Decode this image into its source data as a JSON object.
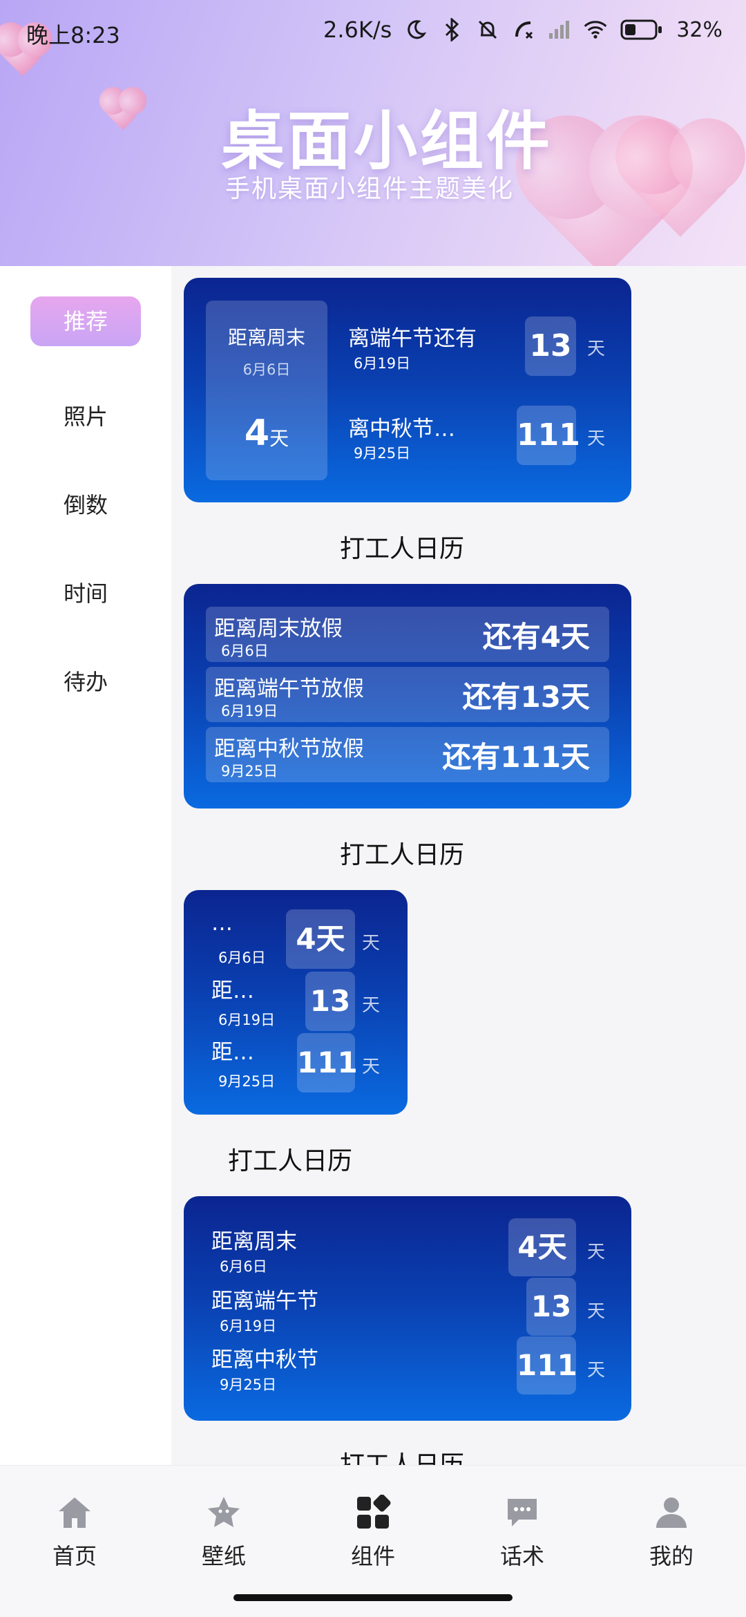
{
  "status_bar": {
    "time": "晚上8:23",
    "network_speed": "2.6K/s",
    "battery": "32%"
  },
  "header": {
    "title": "桌面小组件",
    "subtitle": "手机桌面小组件主题美化"
  },
  "sidebar": {
    "items": [
      {
        "label": "推荐",
        "active": true
      },
      {
        "label": "照片"
      },
      {
        "label": "倒数"
      },
      {
        "label": "时间"
      },
      {
        "label": "待办"
      }
    ]
  },
  "widgets": [
    {
      "caption": "打工人日历",
      "left_panel": {
        "label": "距离周末",
        "date": "6月6日",
        "days": "4",
        "unit": "天"
      },
      "rows": [
        {
          "label": "离端午节还有",
          "date": "6月19日",
          "days": "13",
          "unit": "天"
        },
        {
          "label": "离中秋节…",
          "date": "9月25日",
          "days": "111",
          "unit": "天"
        }
      ]
    },
    {
      "caption": "打工人日历",
      "rows": [
        {
          "label": "距离周末放假",
          "date": "6月6日",
          "text": "还有4天"
        },
        {
          "label": "距离端午节放假",
          "date": "6月19日",
          "text": "还有13天"
        },
        {
          "label": "距离中秋节放假",
          "date": "9月25日",
          "text": "还有111天"
        }
      ]
    },
    {
      "caption": "打工人日历",
      "rows": [
        {
          "label": "…",
          "date": "6月6日",
          "days": "4天",
          "unit": "天"
        },
        {
          "label": "距…",
          "date": "6月19日",
          "days": "13",
          "unit": "天"
        },
        {
          "label": "距…",
          "date": "9月25日",
          "days": "111",
          "unit": "天"
        }
      ]
    },
    {
      "caption": "打工人日历",
      "rows": [
        {
          "label": "距离周末",
          "date": "6月6日",
          "days": "4天",
          "unit": "天"
        },
        {
          "label": "距离端午节",
          "date": "6月19日",
          "days": "13",
          "unit": "天"
        },
        {
          "label": "距离中秋节",
          "date": "9月25日",
          "days": "111",
          "unit": "天"
        }
      ]
    }
  ],
  "bottom_nav": {
    "items": [
      {
        "label": "首页",
        "icon": "home-icon"
      },
      {
        "label": "壁纸",
        "icon": "star-icon"
      },
      {
        "label": "组件",
        "icon": "widgets-icon",
        "active": true
      },
      {
        "label": "话术",
        "icon": "chat-icon"
      },
      {
        "label": "我的",
        "icon": "profile-icon"
      }
    ]
  },
  "colors": {
    "card_top": "#0b2590",
    "card_bottom": "#0a6ae0",
    "accent_pink": "#e7a6ee",
    "accent_purple": "#c8a5f5"
  }
}
